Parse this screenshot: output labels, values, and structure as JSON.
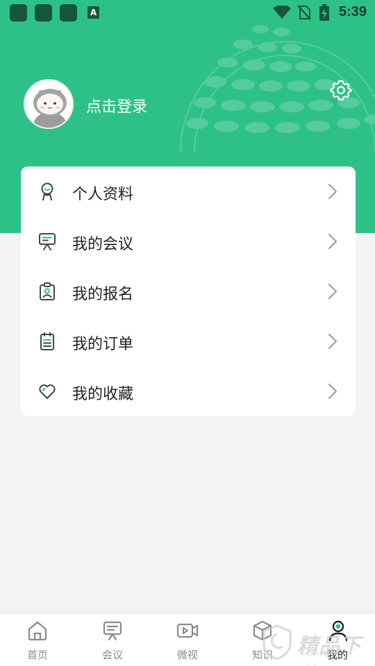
{
  "status_bar": {
    "time": "5:39",
    "notification_icons": [
      "app-icon",
      "app-icon",
      "app-icon",
      "a-icon"
    ],
    "a_label": "A",
    "status_icons": [
      "wifi-icon",
      "no-sim-icon",
      "battery-charging-icon"
    ]
  },
  "profile": {
    "login_prompt": "点击登录",
    "avatar_icon": "default-avatar",
    "settings_icon": "gear-icon"
  },
  "menu": {
    "items": [
      {
        "label": "个人资料",
        "icon": "person-icon"
      },
      {
        "label": "我的会议",
        "icon": "presentation-board-icon"
      },
      {
        "label": "我的报名",
        "icon": "badge-icon"
      },
      {
        "label": "我的订单",
        "icon": "clipboard-list-icon"
      },
      {
        "label": "我的收藏",
        "icon": "heart-icon"
      }
    ]
  },
  "tabbar": {
    "tabs": [
      {
        "label": "首页",
        "icon": "home-icon",
        "active": false
      },
      {
        "label": "会议",
        "icon": "presentation-board-icon",
        "active": false
      },
      {
        "label": "微视",
        "icon": "video-icon",
        "active": false
      },
      {
        "label": "知识",
        "icon": "cube-icon",
        "active": false
      },
      {
        "label": "我的",
        "icon": "user-icon",
        "active": true
      }
    ]
  },
  "watermark": {
    "text": "精品下载",
    "sub": "jinpin.com"
  },
  "colors": {
    "accent": "#2ec187",
    "background": "#f2f3f5",
    "card": "#ffffff",
    "icon": "#3d4550"
  }
}
